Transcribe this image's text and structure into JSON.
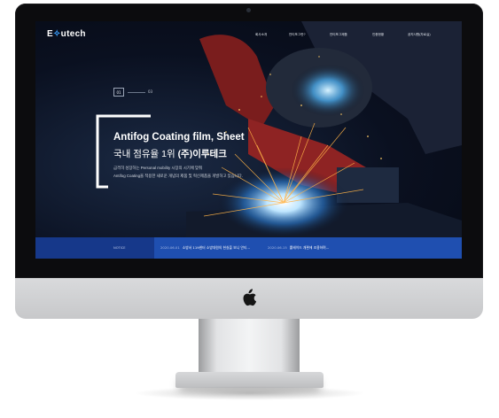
{
  "site": {
    "logo_prefix": "E",
    "logo_accent": "✧",
    "logo_suffix": "utech"
  },
  "nav": {
    "items": [
      {
        "label": "회사소개"
      },
      {
        "label": "안티포그란?"
      },
      {
        "label": "안티포그제품"
      },
      {
        "label": "인증현황"
      },
      {
        "label": "공지사항(자료실)"
      }
    ]
  },
  "hero": {
    "slide_current": "01",
    "slide_total": "03",
    "title": "Antifog Coating film, Sheet",
    "subtitle_prefix": "국내 점유율 1위",
    "subtitle_company": "(주)이루테크",
    "desc_line1": "급격히 성장하는 Personal mobility 시장의 시기에 맞춰",
    "desc_line2": "Antifog Coating을 적용한 새로운 개념의 제품 및 혁신제품을 개발하고 있습니다."
  },
  "news": {
    "label": "NOTICE",
    "items": [
      {
        "date": "2020.06.01",
        "text": "소방서 119센터 소방대원의 헌실을 보니 안티..."
      },
      {
        "date": "2020.06.15",
        "text": "롤헤이드 개편에 조용하며..."
      }
    ]
  },
  "colors": {
    "news_bar": "#1f4fb0",
    "logo_accent": "#3aa0ff"
  }
}
